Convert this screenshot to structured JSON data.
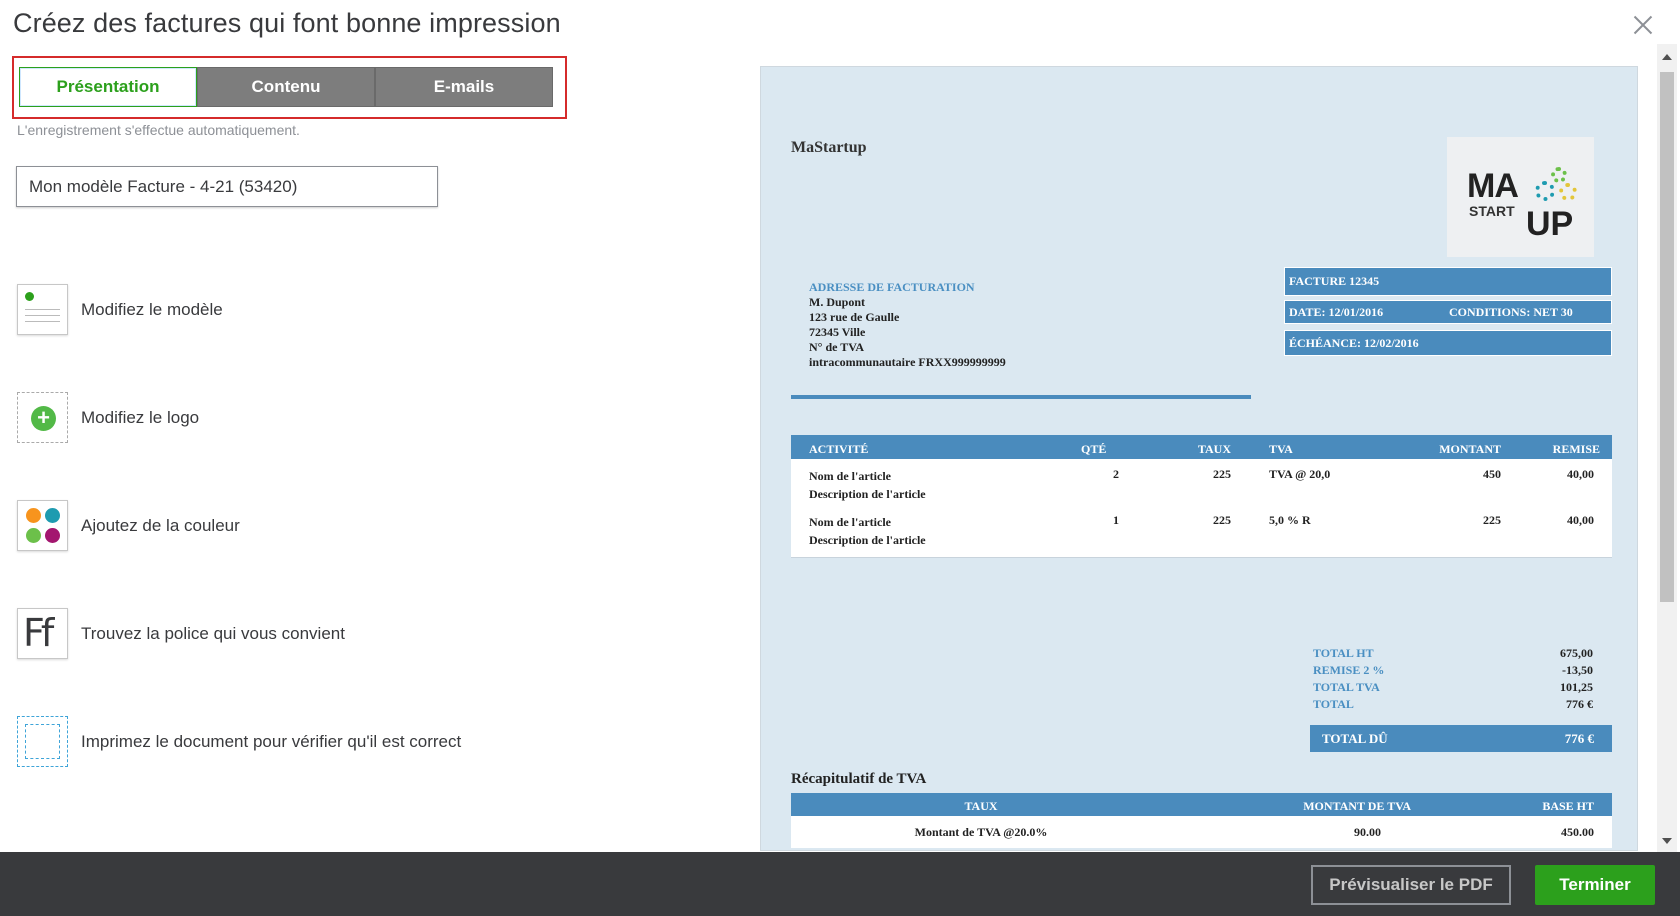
{
  "header": {
    "title": "Créez des factures qui font bonne impression"
  },
  "tabs": [
    {
      "label": "Présentation",
      "active": true
    },
    {
      "label": "Contenu",
      "active": false
    },
    {
      "label": "E-mails",
      "active": false
    }
  ],
  "autosave_text": "L'enregistrement s'effectue automatiquement.",
  "template_name": {
    "value": "Mon modèle Facture - 4-21 (53420)"
  },
  "options": [
    {
      "label": "Modifiez le modèle",
      "icon": "template-icon"
    },
    {
      "label": "Modifiez le logo",
      "icon": "add-logo-icon"
    },
    {
      "label": "Ajoutez de la couleur",
      "icon": "color-palette-icon"
    },
    {
      "label": "Trouvez la police qui vous convient",
      "icon": "font-icon"
    },
    {
      "label": "Imprimez le document pour vérifier qu'il est correct",
      "icon": "print-check-icon"
    }
  ],
  "font_icon_text": "Ff",
  "invoice": {
    "company": "MaStartup",
    "logo": {
      "line1": "MA",
      "line2": "START",
      "line3": "UP"
    },
    "billing": {
      "heading": "ADRESSE DE FACTURATION",
      "name": "M. Dupont",
      "street": "123 rue de Gaulle",
      "city": "72345 Ville",
      "vat_line1": "N° de TVA",
      "vat_line2": "intracommunautaire FRXX999999999"
    },
    "meta": {
      "invoice": "FACTURE  12345",
      "date": "DATE:  12/01/2016",
      "terms": "CONDITIONS:  NET 30",
      "due": "ÉCHÉANCE: 12/02/2016"
    },
    "table_headers": [
      "ACTIVITÉ",
      "QTÉ",
      "TAUX",
      "TVA",
      "MONTANT",
      "REMISE"
    ],
    "rows": [
      {
        "name": "Nom de l'article",
        "desc": "Description de l'article",
        "qty": "2",
        "rate": "225",
        "vat": "TVA @ 20,0",
        "amount": "450",
        "discount": "40,00"
      },
      {
        "name": "Nom de l'article",
        "desc": "Description de l'article",
        "qty": "1",
        "rate": "225",
        "vat": "5,0 % R",
        "amount": "225",
        "discount": "40,00"
      }
    ],
    "totals": [
      {
        "label": "TOTAL HT",
        "value": "675,00"
      },
      {
        "label": "REMISE 2 %",
        "value": "-13,50"
      },
      {
        "label": "TOTAL TVA",
        "value": "101,25"
      },
      {
        "label": "TOTAL",
        "value": "776 €"
      }
    ],
    "total_due": {
      "label": "TOTAL DÛ",
      "value": "776 €"
    },
    "recap": {
      "title": "Récapitulatif de TVA",
      "headers": [
        "TAUX",
        "MONTANT DE TVA",
        "BASE HT"
      ],
      "row": [
        "Montant de TVA @20.0%",
        "90.00",
        "450.00"
      ]
    }
  },
  "footer": {
    "preview_pdf": "Prévisualiser le PDF",
    "done": "Terminer"
  },
  "colors": {
    "accent": "#2ca01c",
    "invoice_blue": "#4a8bbd",
    "preview_bg": "#dbe8f1",
    "highlight_box": "#d52b2b"
  }
}
